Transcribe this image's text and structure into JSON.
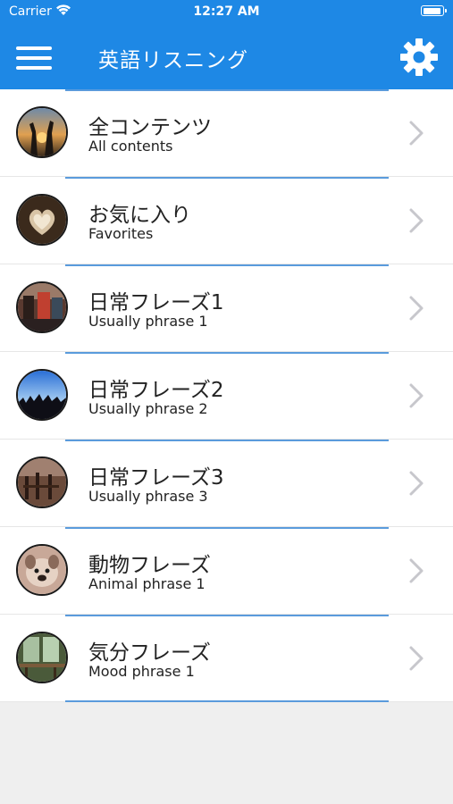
{
  "status_bar": {
    "carrier": "Carrier",
    "time": "12:27 AM",
    "wifi_icon": "wifi-icon",
    "battery_icon": "battery-icon"
  },
  "nav": {
    "title": "英語リスニング",
    "menu_icon": "hamburger-menu-icon",
    "settings_icon": "gear-icon"
  },
  "colors": {
    "accent": "#1e88e5",
    "divider": "#5a9bdc",
    "background": "#efefef"
  },
  "items": [
    {
      "title": "全コンテンツ",
      "subtitle": "All contents",
      "icon": "chevron-right-icon"
    },
    {
      "title": "お気に入り",
      "subtitle": "Favorites",
      "icon": "chevron-right-icon"
    },
    {
      "title": "日常フレーズ1",
      "subtitle": "Usually phrase 1",
      "icon": "chevron-right-icon"
    },
    {
      "title": "日常フレーズ2",
      "subtitle": "Usually phrase 2",
      "icon": "chevron-right-icon"
    },
    {
      "title": "日常フレーズ3",
      "subtitle": "Usually phrase 3",
      "icon": "chevron-right-icon"
    },
    {
      "title": "動物フレーズ",
      "subtitle": "Animal phrase 1",
      "icon": "chevron-right-icon"
    },
    {
      "title": "気分フレーズ",
      "subtitle": "Mood phrase 1",
      "icon": "chevron-right-icon"
    }
  ]
}
